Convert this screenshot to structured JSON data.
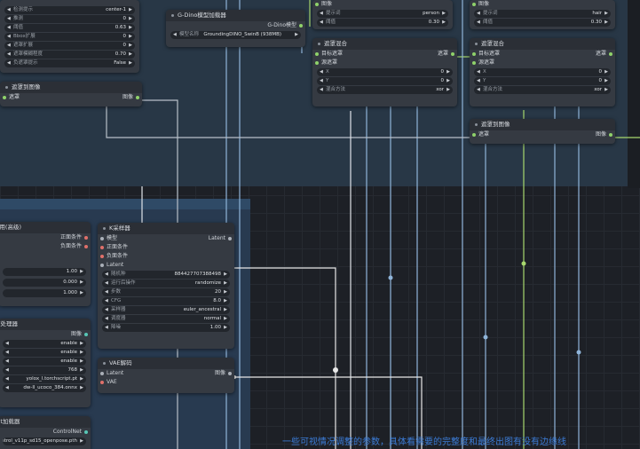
{
  "nodes": {
    "detect_settings": {
      "widgets": [
        {
          "k": "检测提示",
          "v": "center-1"
        },
        {
          "k": "推测",
          "v": "0"
        },
        {
          "k": "阈值",
          "v": "0.63"
        },
        {
          "k": "Bbox扩展",
          "v": "0"
        },
        {
          "k": "遮罩扩展",
          "v": "0"
        },
        {
          "k": "遮罩模糊程度",
          "v": "0.70"
        },
        {
          "k": "负遮罩提示",
          "v": "False"
        }
      ]
    },
    "gdino_loader": {
      "title": "G-Dino模型加载器",
      "out": "G-Dino模型",
      "w_k": "模型名称",
      "w_v": "GroundingDINO_SwinB (938MB)"
    },
    "detect_top": {
      "in": "图像",
      "w": [
        {
          "k": "提示词",
          "v": "person"
        },
        {
          "k": "阈值",
          "v": "0.30"
        }
      ]
    },
    "mask_combine": {
      "title": "遮罩混合",
      "inputs": [
        "目标遮罩",
        "源遮罩"
      ],
      "out": "遮罩",
      "widgets": [
        {
          "k": "X",
          "v": "0"
        },
        {
          "k": "Y",
          "v": "0"
        },
        {
          "k": "混合方法",
          "v": "xor"
        }
      ]
    },
    "detect_right": {
      "in": "图像",
      "w": [
        {
          "k": "提示词",
          "v": "hair"
        },
        {
          "k": "阈值",
          "v": "0.30"
        }
      ]
    },
    "mask_composite": {
      "title": "遮罩混合",
      "inputs": [
        "目标遮罩",
        "源遮罩"
      ],
      "out": "遮罩",
      "widgets": [
        {
          "k": "X",
          "v": "0"
        },
        {
          "k": "Y",
          "v": "0"
        },
        {
          "k": "混合方法",
          "v": "xor"
        }
      ]
    },
    "mask_to_image_left": {
      "title": "遮罩到图像",
      "in": "遮罩",
      "out": "图像"
    },
    "mask_to_image_right": {
      "title": "遮罩到图像",
      "in": "遮罩",
      "out": "图像"
    },
    "controlnet_apply": {
      "title": "ControlNet应用(高级)",
      "outs": [
        "正面条件",
        "负面条件"
      ],
      "vals": [
        "1.00",
        "0.000",
        "1.000"
      ]
    },
    "ksampler": {
      "title": "K采样器",
      "inputs": [
        "模型",
        "正面条件",
        "负面条件",
        "Latent"
      ],
      "out": "Latent",
      "widgets": [
        {
          "k": "随机种",
          "v": "884427707388498"
        },
        {
          "k": "运行后操作",
          "v": "randomize"
        },
        {
          "k": "步数",
          "v": "20"
        },
        {
          "k": "CFG",
          "v": "8.0"
        },
        {
          "k": "采样器",
          "v": "euler_ancestral"
        },
        {
          "k": "调度器",
          "v": "normal"
        },
        {
          "k": "降噪",
          "v": "1.00"
        }
      ]
    },
    "preprocessor": {
      "title": "预处理器",
      "out": "图像",
      "vals": [
        "enable",
        "enable",
        "enable",
        "768",
        "yolox_l.torchscript.pt",
        "dw-ll_ucoco_384.onnx"
      ]
    },
    "vae_decode": {
      "title": "VAE解码",
      "inputs": [
        "Latent",
        "VAE"
      ],
      "out": "图像"
    },
    "controlnet_loader": {
      "title": "ControlNet加载器",
      "out": "ControlNet",
      "w_v": "control_v11p_sd15_openpose.pth"
    }
  },
  "banner": "一些可视情况调整的参数，具体看需要的完整度和最终出图有没有边缘线",
  "colors": {
    "wire_green": "#a8d86e",
    "wire_white": "#e8e8e8",
    "wire_blue": "#8fb4d9",
    "group_bg": "#2a3a4c",
    "accent": "#3b7bd6"
  }
}
